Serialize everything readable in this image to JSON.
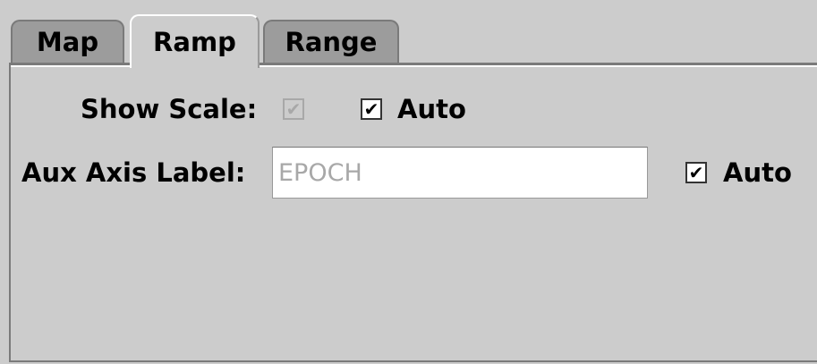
{
  "tabs": [
    {
      "label": "Map",
      "selected": false
    },
    {
      "label": "Ramp",
      "selected": true
    },
    {
      "label": "Range",
      "selected": false
    }
  ],
  "form": {
    "show_scale_label": "Show Scale:",
    "show_scale_checked": true,
    "show_scale_enabled": false,
    "show_scale_auto_label": "Auto",
    "show_scale_auto_checked": true,
    "aux_axis_label_label": "Aux Axis Label:",
    "aux_axis_label_value": "EPOCH",
    "aux_axis_label_enabled": false,
    "aux_auto_label": "Auto",
    "aux_auto_checked": true
  },
  "glyphs": {
    "check": "✔"
  },
  "colors": {
    "background": "#cccccc",
    "tab_inactive": "#9c9c9c",
    "disabled_text": "#a8a8a8"
  }
}
